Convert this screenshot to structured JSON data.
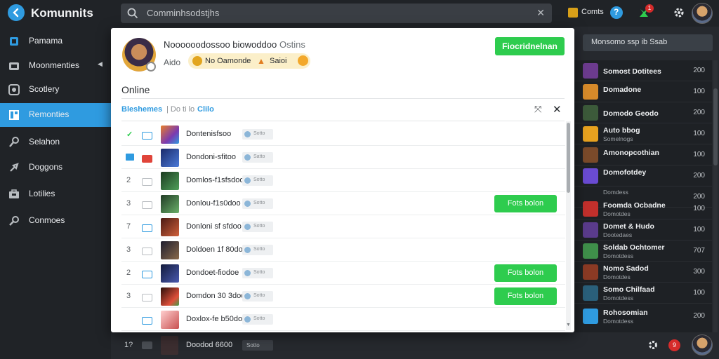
{
  "app": {
    "name": "Komunnits"
  },
  "search": {
    "text": "Comminhsodstjhs"
  },
  "topbar": {
    "items_label": "Comts",
    "help_glyph": "?",
    "notif_count": "1"
  },
  "sidebar": {
    "items": [
      {
        "label": "Pamama",
        "icon": "bookmark-icon"
      },
      {
        "label": "Moonmenties",
        "icon": "folder-icon",
        "chevron": "◀"
      },
      {
        "label": "Scotlery",
        "icon": "gallery-icon"
      },
      {
        "label": "Remonties",
        "icon": "library-icon",
        "active": true
      },
      {
        "label": "Selahon",
        "icon": "wrench-icon"
      },
      {
        "label": "Doggons",
        "icon": "puzzle-icon"
      },
      {
        "label": "Lotilies",
        "icon": "briefcase-icon"
      },
      {
        "label": "Conmoes",
        "icon": "key-icon"
      }
    ]
  },
  "right_panel": {
    "button_label": "Monsomo ssp ib Ssab",
    "items": [
      {
        "title": "Somost Dotitees",
        "sub": "",
        "count": "200",
        "color": "#6c3b8e"
      },
      {
        "title": "Domadone",
        "sub": "",
        "count": "100",
        "color": "#d68a2a"
      },
      {
        "title": "Domodo Geodo",
        "sub": "",
        "count": "200",
        "color": "#3c5a3a"
      },
      {
        "title": "Auto bbog",
        "sub": "Somelnogs",
        "count": "100",
        "color": "#e8a21f"
      },
      {
        "title": "Amonopcothian",
        "sub": "",
        "count": "100",
        "color": "#7a4a2a"
      },
      {
        "title": "Domofotdey",
        "sub": "",
        "count": "200",
        "color": "#6a4bd3"
      },
      {
        "title": "",
        "sub": "Domdess",
        "count": "200",
        "color": "#2f3640"
      },
      {
        "title": "Foomda Ocbadne",
        "sub": "Domotdes",
        "count": "100",
        "color": "#c2302c"
      },
      {
        "title": "Domet & Hudo",
        "sub": "Dootedaes",
        "count": "100",
        "color": "#5a3b8b"
      },
      {
        "title": "Soldab Ochtomer",
        "sub": "Domotdess",
        "count": "707",
        "color": "#3f8f4a"
      },
      {
        "title": "Nomo Sadod",
        "sub": "Domotdes",
        "count": "300",
        "color": "#8b3a24"
      },
      {
        "title": "Somo Chilfaad",
        "sub": "Domotdess",
        "count": "100",
        "color": "#2a5f7a"
      },
      {
        "title": "Rohosomian",
        "sub": "Domotdess",
        "count": "200",
        "color": "#2f9be0"
      }
    ]
  },
  "background_row": {
    "num": "1?",
    "title": "Doodod 6600",
    "tag": "Sotto"
  },
  "modal": {
    "name": "Noooooodossoo biowoddoo",
    "name_sub": "Ostins",
    "status_label": "Aido",
    "pill_text": "No Oamonde",
    "pill_text2": "Saioi",
    "cta_label": "Fiocridnelnan",
    "section_title": "Online",
    "filter": {
      "tab": "Bleshemes",
      "sep": "| Do ti lo",
      "extra": "Clilo"
    },
    "rows": [
      {
        "num": "",
        "title": "Dontenisfsoo",
        "tag": "Sotto",
        "action": "",
        "thumb": "#e87e2a",
        "chk": "green"
      },
      {
        "num": "",
        "title": "Dondoni-sfitoo",
        "tag": "Satto",
        "action": "",
        "thumb": "#2f4aa0",
        "chk": "blue"
      },
      {
        "num": "2",
        "title": "Domlos-f1sfsdoo",
        "tag": "Sotto",
        "action": "",
        "thumb": "#2f6a3a",
        "chk": ""
      },
      {
        "num": "3",
        "title": "Donlou-f1s0doo",
        "tag": "Sotto",
        "action": "Fots bolon",
        "thumb": "#3a6b3a",
        "chk": ""
      },
      {
        "num": "7",
        "title": "Donloni sf sfdoo",
        "tag": "Sotto",
        "action": "",
        "thumb": "#8a3a2a",
        "chk": "blue"
      },
      {
        "num": "3",
        "title": "Doldoen 1f 80doo",
        "tag": "Sotto",
        "action": "",
        "thumb": "#5a3a2a",
        "chk": ""
      },
      {
        "num": "2",
        "title": "Dondoet-fiodoe",
        "tag": "Sotto",
        "action": "Fots bolon",
        "thumb": "#2a3a7a",
        "chk": "blue"
      },
      {
        "num": "3",
        "title": "Domdon 30 3doo",
        "tag": "Sotto",
        "action": "Fots bolon",
        "thumb": "#b03a2a",
        "chk": ""
      },
      {
        "num": "",
        "title": "Doxlox-fe b50doo",
        "tag": "Sotto",
        "action": "",
        "thumb": "#c85050",
        "chk": "blue"
      }
    ]
  },
  "footer": {
    "notif_count": "9"
  }
}
